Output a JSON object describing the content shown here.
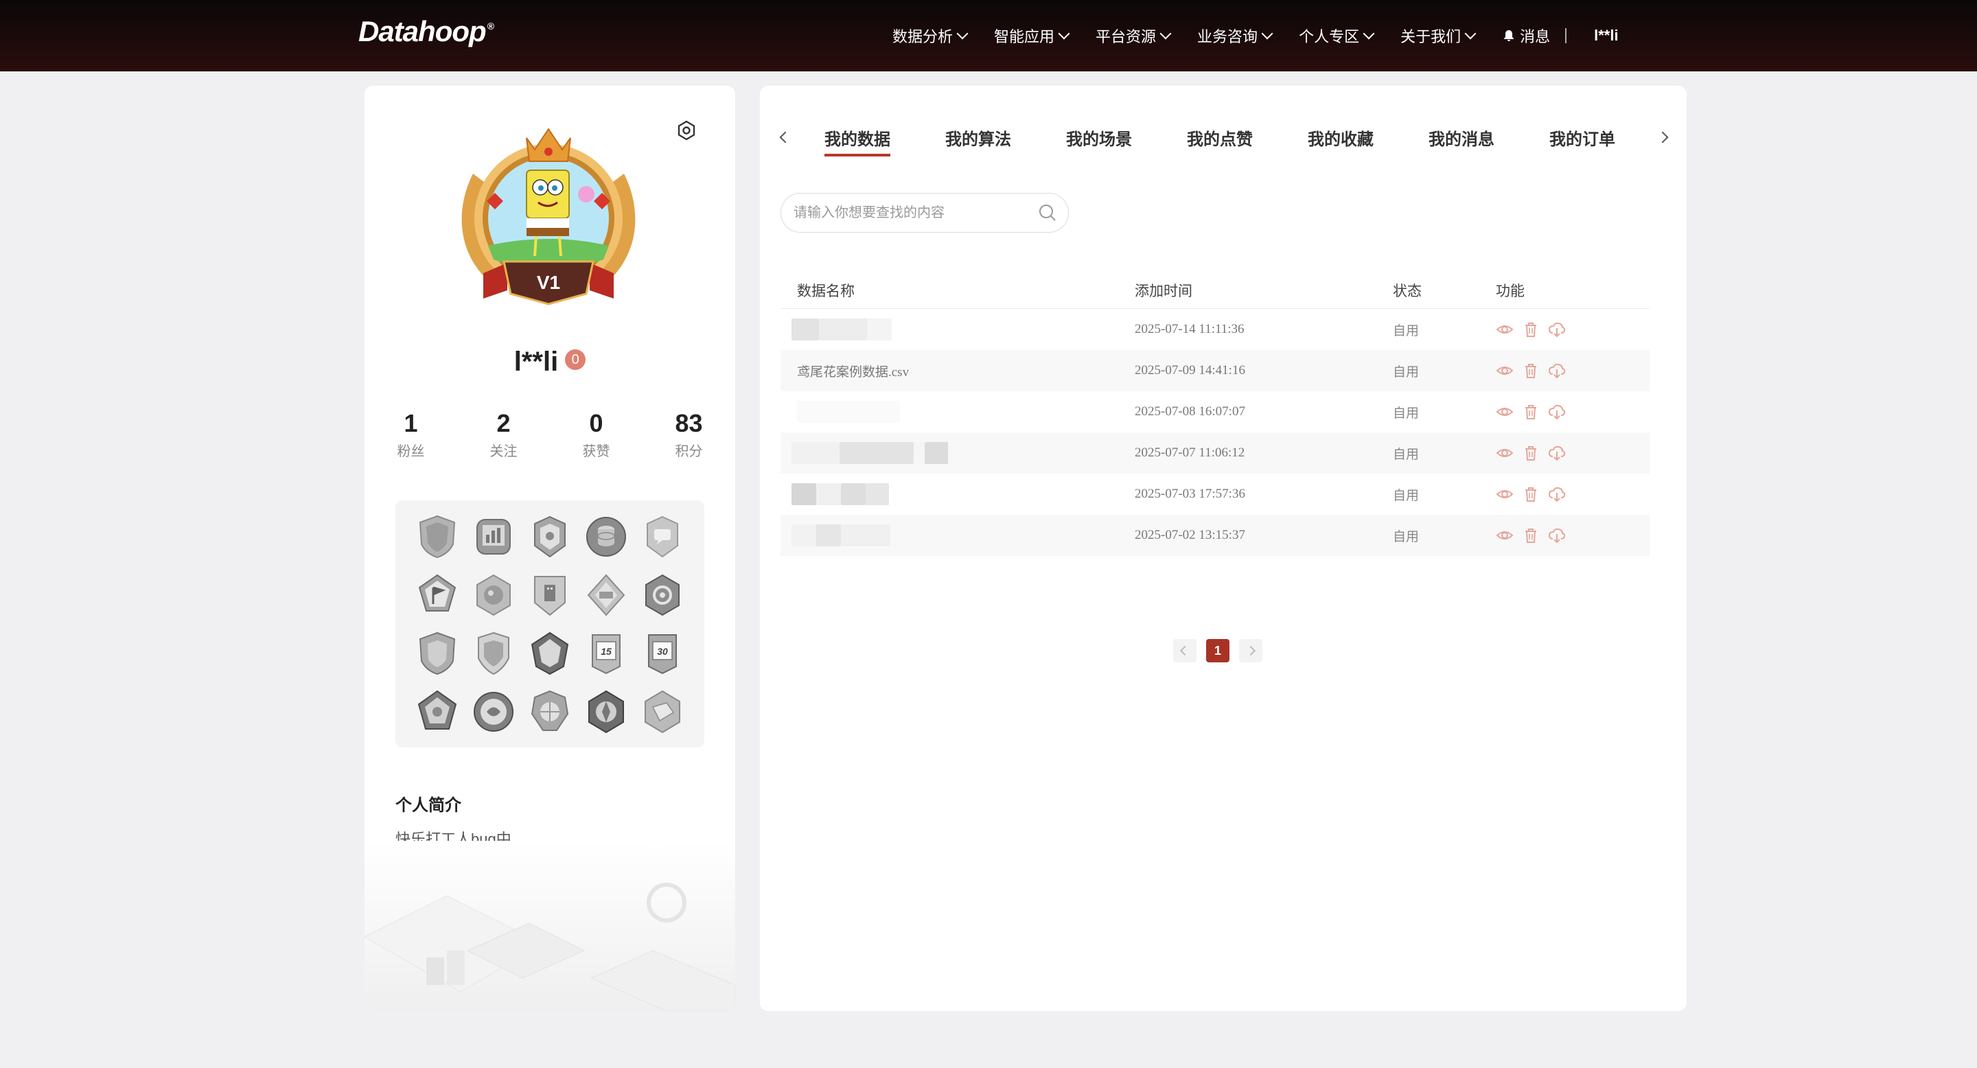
{
  "nav": {
    "logo": "Datahoop",
    "logo_mark": "®",
    "items": [
      {
        "label": "数据分析"
      },
      {
        "label": "智能应用"
      },
      {
        "label": "平台资源"
      },
      {
        "label": "业务咨询"
      },
      {
        "label": "个人专区"
      },
      {
        "label": "关于我们"
      }
    ],
    "messages_label": "消息",
    "user": "l**li"
  },
  "profile": {
    "level": "V1",
    "name": "l**li",
    "badge_count": "0",
    "stats": [
      {
        "value": "1",
        "label": "粉丝"
      },
      {
        "value": "2",
        "label": "关注"
      },
      {
        "value": "0",
        "label": "获赞"
      },
      {
        "value": "83",
        "label": "积分"
      }
    ],
    "badge_texts": [
      "15",
      "30"
    ],
    "bio_title": "个人简介",
    "bio_text": "快乐打工人bug中"
  },
  "tabs": [
    {
      "label": "我的数据",
      "active": true
    },
    {
      "label": "我的算法"
    },
    {
      "label": "我的场景"
    },
    {
      "label": "我的点赞"
    },
    {
      "label": "我的收藏"
    },
    {
      "label": "我的消息"
    },
    {
      "label": "我的订单"
    }
  ],
  "search": {
    "placeholder": "请输入你想要查找的内容"
  },
  "table": {
    "headers": [
      "数据名称",
      "添加时间",
      "状态",
      "功能"
    ],
    "rows": [
      {
        "name": "",
        "time": "2025-07-14 11:11:36",
        "status": "自用"
      },
      {
        "name": "鸢尾花案例数据.csv",
        "time": "2025-07-09 14:41:16",
        "status": "自用"
      },
      {
        "name": "",
        "time": "2025-07-08 16:07:07",
        "status": "自用"
      },
      {
        "name": "",
        "time": "2025-07-07 11:06:12",
        "status": "自用"
      },
      {
        "name": "",
        "time": "2025-07-03 17:57:36",
        "status": "自用"
      },
      {
        "name": "",
        "time": "2025-07-02 13:15:37",
        "status": "自用"
      }
    ]
  },
  "pagination": {
    "current": "1"
  },
  "colors": {
    "accent": "#b53a2a",
    "action_icon": "#e6a69a",
    "nav_bg": "#1a0808"
  }
}
